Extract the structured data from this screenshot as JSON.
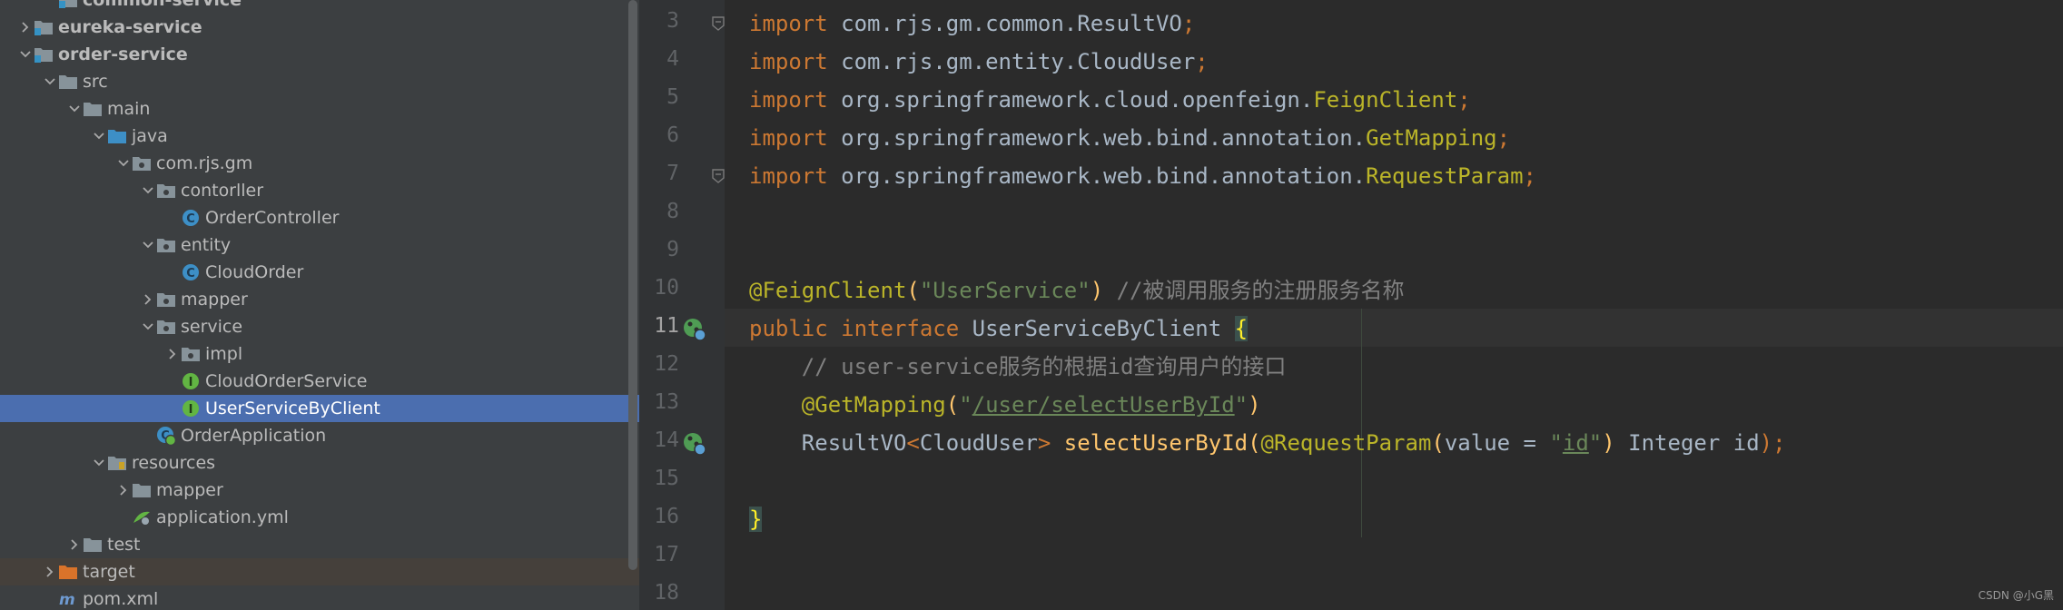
{
  "tree": {
    "items": [
      {
        "label": "common-service",
        "bold": true,
        "arrow": "",
        "icon": "module-folder-icon",
        "selected": false,
        "excluded": false
      },
      {
        "label": "eureka-service",
        "bold": true,
        "arrow": "right",
        "icon": "module-folder-icon",
        "selected": false,
        "excluded": false
      },
      {
        "label": "order-service",
        "bold": true,
        "arrow": "down",
        "icon": "module-folder-icon",
        "selected": false,
        "excluded": false
      },
      {
        "label": "src",
        "bold": false,
        "arrow": "down",
        "icon": "folder-icon",
        "selected": false,
        "excluded": false
      },
      {
        "label": "main",
        "bold": false,
        "arrow": "down",
        "icon": "folder-icon",
        "selected": false,
        "excluded": false
      },
      {
        "label": "java",
        "bold": false,
        "arrow": "down",
        "icon": "source-folder-icon",
        "selected": false,
        "excluded": false
      },
      {
        "label": "com.rjs.gm",
        "bold": false,
        "arrow": "down",
        "icon": "package-icon",
        "selected": false,
        "excluded": false
      },
      {
        "label": "contorller",
        "bold": false,
        "arrow": "down",
        "icon": "package-icon",
        "selected": false,
        "excluded": false
      },
      {
        "label": "OrderController",
        "bold": false,
        "arrow": "",
        "icon": "class-icon",
        "selected": false,
        "excluded": false
      },
      {
        "label": "entity",
        "bold": false,
        "arrow": "down",
        "icon": "package-icon",
        "selected": false,
        "excluded": false
      },
      {
        "label": "CloudOrder",
        "bold": false,
        "arrow": "",
        "icon": "class-icon",
        "selected": false,
        "excluded": false
      },
      {
        "label": "mapper",
        "bold": false,
        "arrow": "right",
        "icon": "package-icon",
        "selected": false,
        "excluded": false
      },
      {
        "label": "service",
        "bold": false,
        "arrow": "down",
        "icon": "package-icon",
        "selected": false,
        "excluded": false
      },
      {
        "label": "impl",
        "bold": false,
        "arrow": "right",
        "icon": "package-icon",
        "selected": false,
        "excluded": false
      },
      {
        "label": "CloudOrderService",
        "bold": false,
        "arrow": "",
        "icon": "interface-icon",
        "selected": false,
        "excluded": false
      },
      {
        "label": "UserServiceByClient",
        "bold": false,
        "arrow": "",
        "icon": "interface-icon",
        "selected": true,
        "excluded": false
      },
      {
        "label": "OrderApplication",
        "bold": false,
        "arrow": "",
        "icon": "spring-class-icon",
        "selected": false,
        "excluded": false
      },
      {
        "label": "resources",
        "bold": false,
        "arrow": "down",
        "icon": "resources-folder-icon",
        "selected": false,
        "excluded": false
      },
      {
        "label": "mapper",
        "bold": false,
        "arrow": "right",
        "icon": "folder-icon",
        "selected": false,
        "excluded": false
      },
      {
        "label": "application.yml",
        "bold": false,
        "arrow": "",
        "icon": "yaml-file-icon",
        "selected": false,
        "excluded": false
      },
      {
        "label": "test",
        "bold": false,
        "arrow": "right",
        "icon": "folder-icon",
        "selected": false,
        "excluded": false
      },
      {
        "label": "target",
        "bold": false,
        "arrow": "right",
        "icon": "excluded-folder-icon",
        "selected": false,
        "excluded": true
      },
      {
        "label": "pom.xml",
        "bold": false,
        "arrow": "",
        "icon": "maven-file-icon",
        "selected": false,
        "excluded": false
      }
    ]
  },
  "editor": {
    "lines": [
      {
        "num": "3",
        "segments": [
          {
            "t": "import ",
            "c": "kw"
          },
          {
            "t": "com.rjs.gm.common.ResultVO",
            "c": ""
          },
          {
            "t": ";",
            "c": "kw"
          }
        ]
      },
      {
        "num": "4",
        "segments": [
          {
            "t": "import ",
            "c": "kw"
          },
          {
            "t": "com.rjs.gm.entity.CloudUser",
            "c": ""
          },
          {
            "t": ";",
            "c": "kw"
          }
        ]
      },
      {
        "num": "5",
        "segments": [
          {
            "t": "import ",
            "c": "kw"
          },
          {
            "t": "org.springframework.cloud.openfeign.",
            "c": ""
          },
          {
            "t": "FeignClient",
            "c": "ann"
          },
          {
            "t": ";",
            "c": "kw"
          }
        ]
      },
      {
        "num": "6",
        "segments": [
          {
            "t": "import ",
            "c": "kw"
          },
          {
            "t": "org.springframework.web.bind.annotation.",
            "c": ""
          },
          {
            "t": "GetMapping",
            "c": "ann"
          },
          {
            "t": ";",
            "c": "kw"
          }
        ]
      },
      {
        "num": "7",
        "segments": [
          {
            "t": "import ",
            "c": "kw"
          },
          {
            "t": "org.springframework.web.bind.annotation.",
            "c": ""
          },
          {
            "t": "RequestParam",
            "c": "ann"
          },
          {
            "t": ";",
            "c": "kw"
          }
        ]
      },
      {
        "num": "8",
        "segments": []
      },
      {
        "num": "9",
        "segments": []
      },
      {
        "num": "10",
        "segments": [
          {
            "t": "@FeignClient",
            "c": "ann"
          },
          {
            "t": "(",
            "c": "fn"
          },
          {
            "t": "\"UserService\"",
            "c": "str"
          },
          {
            "t": ")",
            "c": "fn"
          },
          {
            "t": " //被调用服务的注册服务名称",
            "c": "cm"
          }
        ]
      },
      {
        "num": "11",
        "segments": [
          {
            "t": "public ",
            "c": "kw"
          },
          {
            "t": "interface ",
            "c": "kw"
          },
          {
            "t": "UserServiceByClient ",
            "c": ""
          },
          {
            "t": "{",
            "c": "brace"
          }
        ]
      },
      {
        "num": "12",
        "segments": [
          {
            "t": "    // user-service服务的根据id查询用户的接口",
            "c": "cm"
          }
        ]
      },
      {
        "num": "13",
        "segments": [
          {
            "t": "    ",
            "c": ""
          },
          {
            "t": "@GetMapping",
            "c": "ann"
          },
          {
            "t": "(",
            "c": "fn"
          },
          {
            "t": "\"",
            "c": "str"
          },
          {
            "t": "/user/selectUserById",
            "c": "str u"
          },
          {
            "t": "\"",
            "c": "str"
          },
          {
            "t": ")",
            "c": "fn"
          }
        ]
      },
      {
        "num": "14",
        "segments": [
          {
            "t": "    ResultVO",
            "c": ""
          },
          {
            "t": "<",
            "c": "kw"
          },
          {
            "t": "CloudUser",
            "c": ""
          },
          {
            "t": "> ",
            "c": "kw"
          },
          {
            "t": "selectUserById",
            "c": "fn"
          },
          {
            "t": "(",
            "c": "fn"
          },
          {
            "t": "@RequestParam",
            "c": "ann"
          },
          {
            "t": "(",
            "c": "fn"
          },
          {
            "t": "value = ",
            "c": ""
          },
          {
            "t": "\"",
            "c": "str"
          },
          {
            "t": "id",
            "c": "str u"
          },
          {
            "t": "\"",
            "c": "str"
          },
          {
            "t": ") ",
            "c": "fn"
          },
          {
            "t": "Integer id",
            "c": ""
          },
          {
            "t": ");",
            "c": "kw"
          }
        ]
      },
      {
        "num": "15",
        "segments": []
      },
      {
        "num": "16",
        "segments": [
          {
            "t": "}",
            "c": "brace"
          }
        ]
      },
      {
        "num": "17",
        "segments": []
      },
      {
        "num": "18",
        "segments": []
      }
    ],
    "current_line": "11"
  },
  "watermark": "CSDN @小G黑",
  "colors": {
    "tree_bg": "#3c3f41",
    "selected_bg": "#4b6eaf",
    "editor_bg": "#2b2b2b",
    "keyword": "#cc7832",
    "annotation": "#bbb529",
    "string": "#6a8759",
    "comment": "#808080",
    "method": "#ffc66d"
  }
}
